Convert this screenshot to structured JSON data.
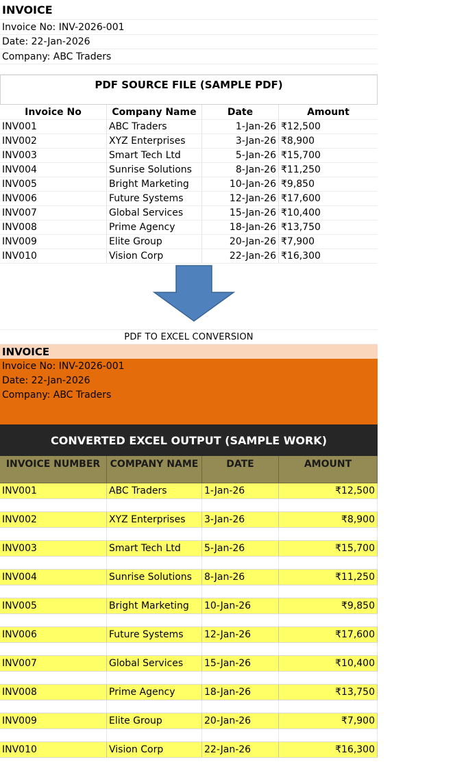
{
  "invoice": {
    "title": "INVOICE",
    "invoice_no": "Invoice No: INV-2026-001",
    "date": "Date: 22-Jan-2026",
    "company": "Company: ABC Traders"
  },
  "pdf_source": {
    "title": "PDF SOURCE FILE (SAMPLE PDF)",
    "headers": [
      "Invoice No",
      "Company Name",
      "Date",
      "Amount"
    ],
    "rows": [
      [
        "INV001",
        "ABC Traders",
        "1-Jan-26",
        "₹12,500"
      ],
      [
        "INV002",
        "XYZ Enterprises",
        "3-Jan-26",
        "₹8,900"
      ],
      [
        "INV003",
        "Smart Tech Ltd",
        "5-Jan-26",
        "₹15,700"
      ],
      [
        "INV004",
        "Sunrise Solutions",
        "8-Jan-26",
        "₹11,250"
      ],
      [
        "INV005",
        "Bright Marketing",
        "10-Jan-26",
        "₹9,850"
      ],
      [
        "INV006",
        "Future Systems",
        "12-Jan-26",
        "₹17,600"
      ],
      [
        "INV007",
        "Global Services",
        "15-Jan-26",
        "₹10,400"
      ],
      [
        "INV008",
        "Prime Agency",
        "18-Jan-26",
        "₹13,750"
      ],
      [
        "INV009",
        "Elite Group",
        "20-Jan-26",
        "₹7,900"
      ],
      [
        "INV010",
        "Vision Corp",
        "22-Jan-26",
        "₹16,300"
      ]
    ]
  },
  "arrow": {
    "icon": "down-arrow-icon",
    "color": "#4f81bd"
  },
  "conversion_label": "PDF TO EXCEL CONVERSION",
  "converted_invoice": {
    "title": "INVOICE",
    "invoice_no": "Invoice No: INV-2026-001",
    "date": "Date: 22-Jan-2026",
    "company": "Company: ABC Traders"
  },
  "excel_output": {
    "title": "CONVERTED EXCEL OUTPUT (SAMPLE WORK)",
    "headers": [
      "INVOICE NUMBER",
      "COMPANY NAME",
      "DATE",
      "AMOUNT"
    ],
    "rows": [
      [
        "INV001",
        "ABC Traders",
        "1-Jan-26",
        "₹12,500"
      ],
      [
        "INV002",
        "XYZ Enterprises",
        "3-Jan-26",
        "₹8,900"
      ],
      [
        "INV003",
        "Smart Tech Ltd",
        "5-Jan-26",
        "₹15,700"
      ],
      [
        "INV004",
        "Sunrise Solutions",
        "8-Jan-26",
        "₹11,250"
      ],
      [
        "INV005",
        "Bright Marketing",
        "10-Jan-26",
        "₹9,850"
      ],
      [
        "INV006",
        "Future Systems",
        "12-Jan-26",
        "₹17,600"
      ],
      [
        "INV007",
        "Global Services",
        "15-Jan-26",
        "₹10,400"
      ],
      [
        "INV008",
        "Prime Agency",
        "18-Jan-26",
        "₹13,750"
      ],
      [
        "INV009",
        "Elite Group",
        "20-Jan-26",
        "₹7,900"
      ],
      [
        "INV010",
        "Vision Corp",
        "22-Jan-26",
        "₹16,300"
      ]
    ]
  },
  "colors": {
    "peach": "#fad6bd",
    "orange": "#e46c0a",
    "dark_header": "#262626",
    "olive_header": "#948a54",
    "yellow_row": "#ffff66"
  }
}
